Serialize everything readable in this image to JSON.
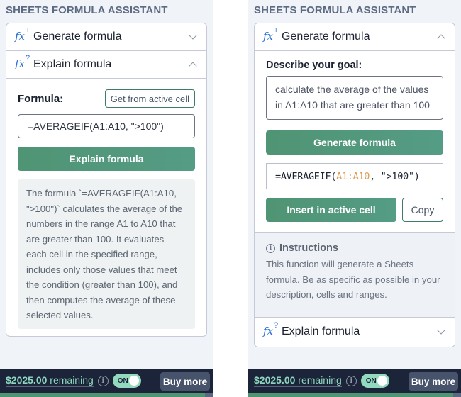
{
  "app_title": "SHEETS FORMULA ASSISTANT",
  "colors": {
    "accent_green": "#4f9473",
    "fx_icon_blue": "#2b6fd3",
    "footer_bg": "#1b2438",
    "credit_text": "#8fd6c0",
    "formula_ref": "#e0994f"
  },
  "left_panel": {
    "sections": [
      {
        "label": "Generate formula",
        "icon": "fx-plus-icon",
        "expanded": false
      },
      {
        "label": "Explain formula",
        "icon": "fx-question-icon",
        "expanded": true
      }
    ],
    "explain": {
      "formula_label": "Formula:",
      "get_cell_button": "Get from active cell",
      "formula_value": "=AVERAGEIF(A1:A10, \">100\")",
      "explain_button": "Explain formula",
      "explanation": "The formula `=AVERAGEIF(A1:A10, \">100\")` calculates the average of the numbers in the range A1 to A10 that are greater than 100. It evaluates each cell in the specified range, includes only those values that meet the condition (greater than 100), and then computes the average of these selected values."
    }
  },
  "right_panel": {
    "sections": [
      {
        "label": "Generate formula",
        "icon": "fx-plus-icon",
        "expanded": true
      },
      {
        "label": "Explain formula",
        "icon": "fx-question-icon",
        "expanded": false
      }
    ],
    "generate": {
      "goal_label": "Describe your goal:",
      "goal_value": "calculate the average of the values in A1:A10 that are greater than 100",
      "generate_button": "Generate formula",
      "result_formula": {
        "prefix": "=AVERAGEIF(",
        "range": "A1:A10",
        "suffix": ", \">100\")"
      },
      "insert_button": "Insert in active cell",
      "copy_button": "Copy"
    },
    "instructions": {
      "title": "Instructions",
      "text": "This function will generate a Sheets formula. Be as specific as possible in your description, cells and ranges."
    }
  },
  "footer": {
    "amount": "$2025.00",
    "remaining_label": "remaining",
    "toggle_label": "ON",
    "toggle_on": true,
    "buy_button": "Buy more"
  },
  "fx_symbols": {
    "f": "fx",
    "plus": "+",
    "question": "?"
  },
  "info_glyph": "i"
}
